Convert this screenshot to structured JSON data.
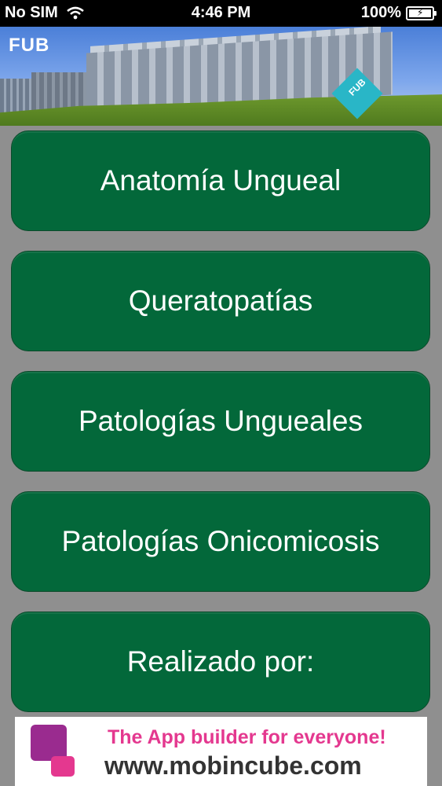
{
  "status_bar": {
    "carrier": "No SIM",
    "time": "4:46 PM",
    "battery": "100%"
  },
  "header": {
    "logo": "FUB",
    "cube_label": "FUB"
  },
  "menu": {
    "items": [
      {
        "label": "Anatomía Ungueal"
      },
      {
        "label": "Queratopatías"
      },
      {
        "label": "Patologías Ungueales"
      },
      {
        "label": "Patologías Onicomicosis"
      },
      {
        "label": "Realizado por:"
      }
    ]
  },
  "ad": {
    "tagline": "The App builder for everyone!",
    "url": "www.mobincube.com"
  },
  "colors": {
    "button_green": "#03683a",
    "background": "#8f8f8f",
    "ad_pink": "#e4388f"
  }
}
